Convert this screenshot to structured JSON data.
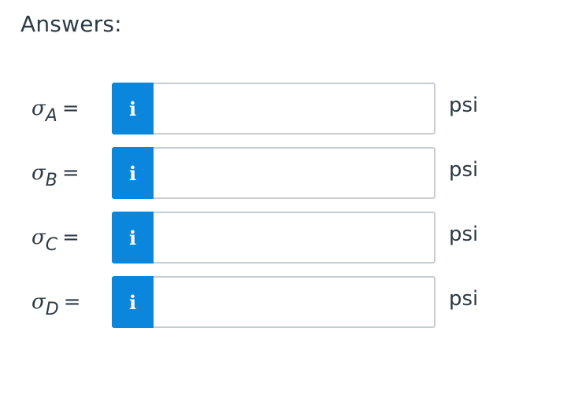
{
  "title": "Answers:",
  "answers": [
    {
      "symbol": "σ",
      "subscript": "A",
      "equals": "=",
      "info_glyph": "i",
      "value": "",
      "unit": "psi"
    },
    {
      "symbol": "σ",
      "subscript": "B",
      "equals": "=",
      "info_glyph": "i",
      "value": "",
      "unit": "psi"
    },
    {
      "symbol": "σ",
      "subscript": "C",
      "equals": "=",
      "info_glyph": "i",
      "value": "",
      "unit": "psi"
    },
    {
      "symbol": "σ",
      "subscript": "D",
      "equals": "=",
      "info_glyph": "i",
      "value": "",
      "unit": "psi"
    }
  ],
  "colors": {
    "info_button": "#0a87dc",
    "input_border": "#c7cdd1",
    "text": "#2d3b45"
  },
  "icons": {
    "info": "info-icon"
  }
}
